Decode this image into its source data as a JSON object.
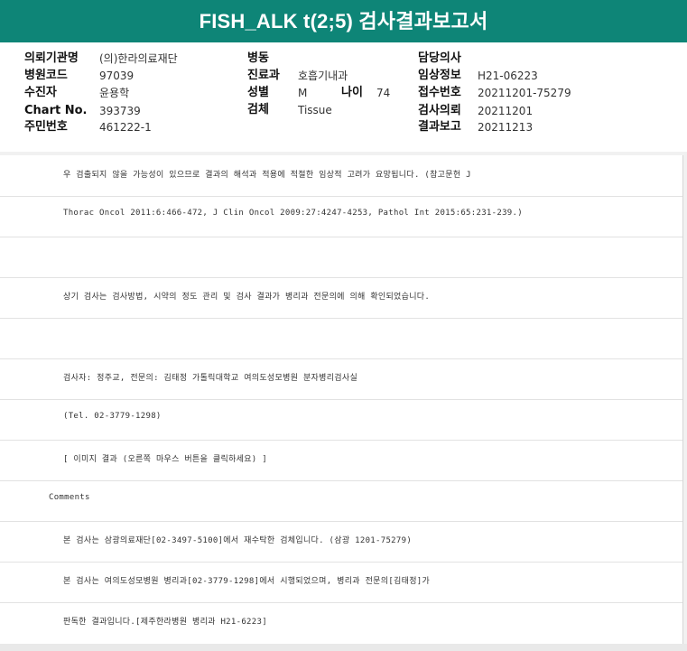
{
  "header": {
    "title": "FISH_ALK t(2;5) 검사결과보고서"
  },
  "info": {
    "col1": [
      {
        "label": "의뢰기관명",
        "value": "(의)한라의료재단"
      },
      {
        "label": "병원코드",
        "value": "97039"
      },
      {
        "label": "수진자",
        "value": "윤용학"
      },
      {
        "label": "Chart No.",
        "value": "393739"
      },
      {
        "label": "주민번호",
        "value": "461222-1"
      }
    ],
    "col2": [
      {
        "label": "병동",
        "value": ""
      },
      {
        "label": "진료과",
        "value": "호흡기내과"
      },
      {
        "label": "성별",
        "value": "M"
      },
      {
        "label": "검체",
        "value": "Tissue"
      }
    ],
    "age": {
      "label": "나이",
      "value": "74"
    },
    "col3": [
      {
        "label": "담당의사",
        "value": ""
      },
      {
        "label": "임상정보",
        "value": "H21-06223"
      },
      {
        "label": "접수번호",
        "value": "20211201-75279"
      },
      {
        "label": "검사의뢰",
        "value": "20211201"
      },
      {
        "label": "결과보고",
        "value": "20211213"
      }
    ]
  },
  "report": {
    "lines": [
      "우 검출되지 않을 가능성이 있으므로 결과의 해석과 적용에 적절한 임상적 고려가 요망됩니다. (참고문헌 J",
      " Thorac Oncol 2011:6:466-472, J Clin Oncol 2009:27:4247-4253,  Pathol Int 2015:65:231-239.)",
      "",
      "상기 검사는 검사방법, 시약의 정도 관리 및 검사 결과가 병리과 전문의에 의해 확인되었습니다.",
      "",
      "검사자: 정주교, 전문의: 김태정 가톨릭대학교 여의도성모병원 분자병리검사실",
      "(Tel. 02-3779-1298)",
      "[ 이미지 결과 (오른쪽 마우스 버튼을 클릭하세요) ]",
      "Comments",
      "본 검사는 삼광의료재단[02-3497-5100]에서 재수탁한 검체입니다. (삼광 1201-75279)",
      "본 검사는 여의도성모병원 병리과[02-3779-1298]에서 시행되었으며, 병리과 전문의[김태정]가",
      "판독한 결과입니다.[제주한라병원 병리과 H21-6223]"
    ]
  }
}
